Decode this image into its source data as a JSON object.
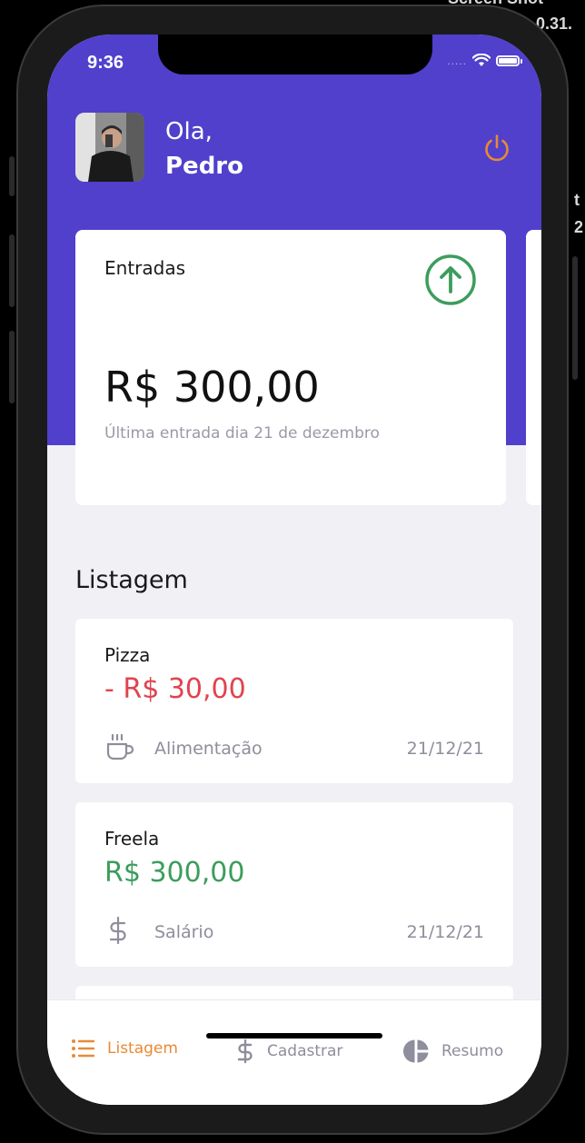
{
  "desktop": {
    "partial_top": "Screen Shot",
    "partial_right_1": "0.31.",
    "partial_right_2": "t",
    "partial_right_3": "2"
  },
  "status_bar": {
    "time": "9:36",
    "signal": "....."
  },
  "header": {
    "greeting": "Ola,",
    "user_name": "Pedro",
    "logout_icon": "power-icon",
    "accent_color": "#5040cc",
    "power_color": "#e88a34"
  },
  "summary_card": {
    "title": "Entradas",
    "value": "R$ 300,00",
    "subtitle": "Última entrada dia 21 de dezembro",
    "icon": "arrow-circle-up-icon",
    "icon_color": "#3c9d5c"
  },
  "list": {
    "title": "Listagem",
    "items": [
      {
        "title": "Pizza",
        "amount": "- R$ 30,00",
        "type": "outcome",
        "amount_color": "#e0444e",
        "category": "Alimentação",
        "category_icon": "coffee-icon",
        "date": "21/12/21"
      },
      {
        "title": "Freela",
        "amount": "R$ 300,00",
        "type": "income",
        "amount_color": "#3c9d5c",
        "category": "Salário",
        "category_icon": "dollar-icon",
        "date": "21/12/21"
      }
    ]
  },
  "tabs": [
    {
      "label": "Listagem",
      "icon": "list-icon",
      "active": true
    },
    {
      "label": "Cadastrar",
      "icon": "dollar-icon",
      "active": false
    },
    {
      "label": "Resumo",
      "icon": "pie-chart-icon",
      "active": false
    }
  ],
  "colors": {
    "active_tab": "#e88a34",
    "inactive_tab": "#8e8e9c"
  }
}
